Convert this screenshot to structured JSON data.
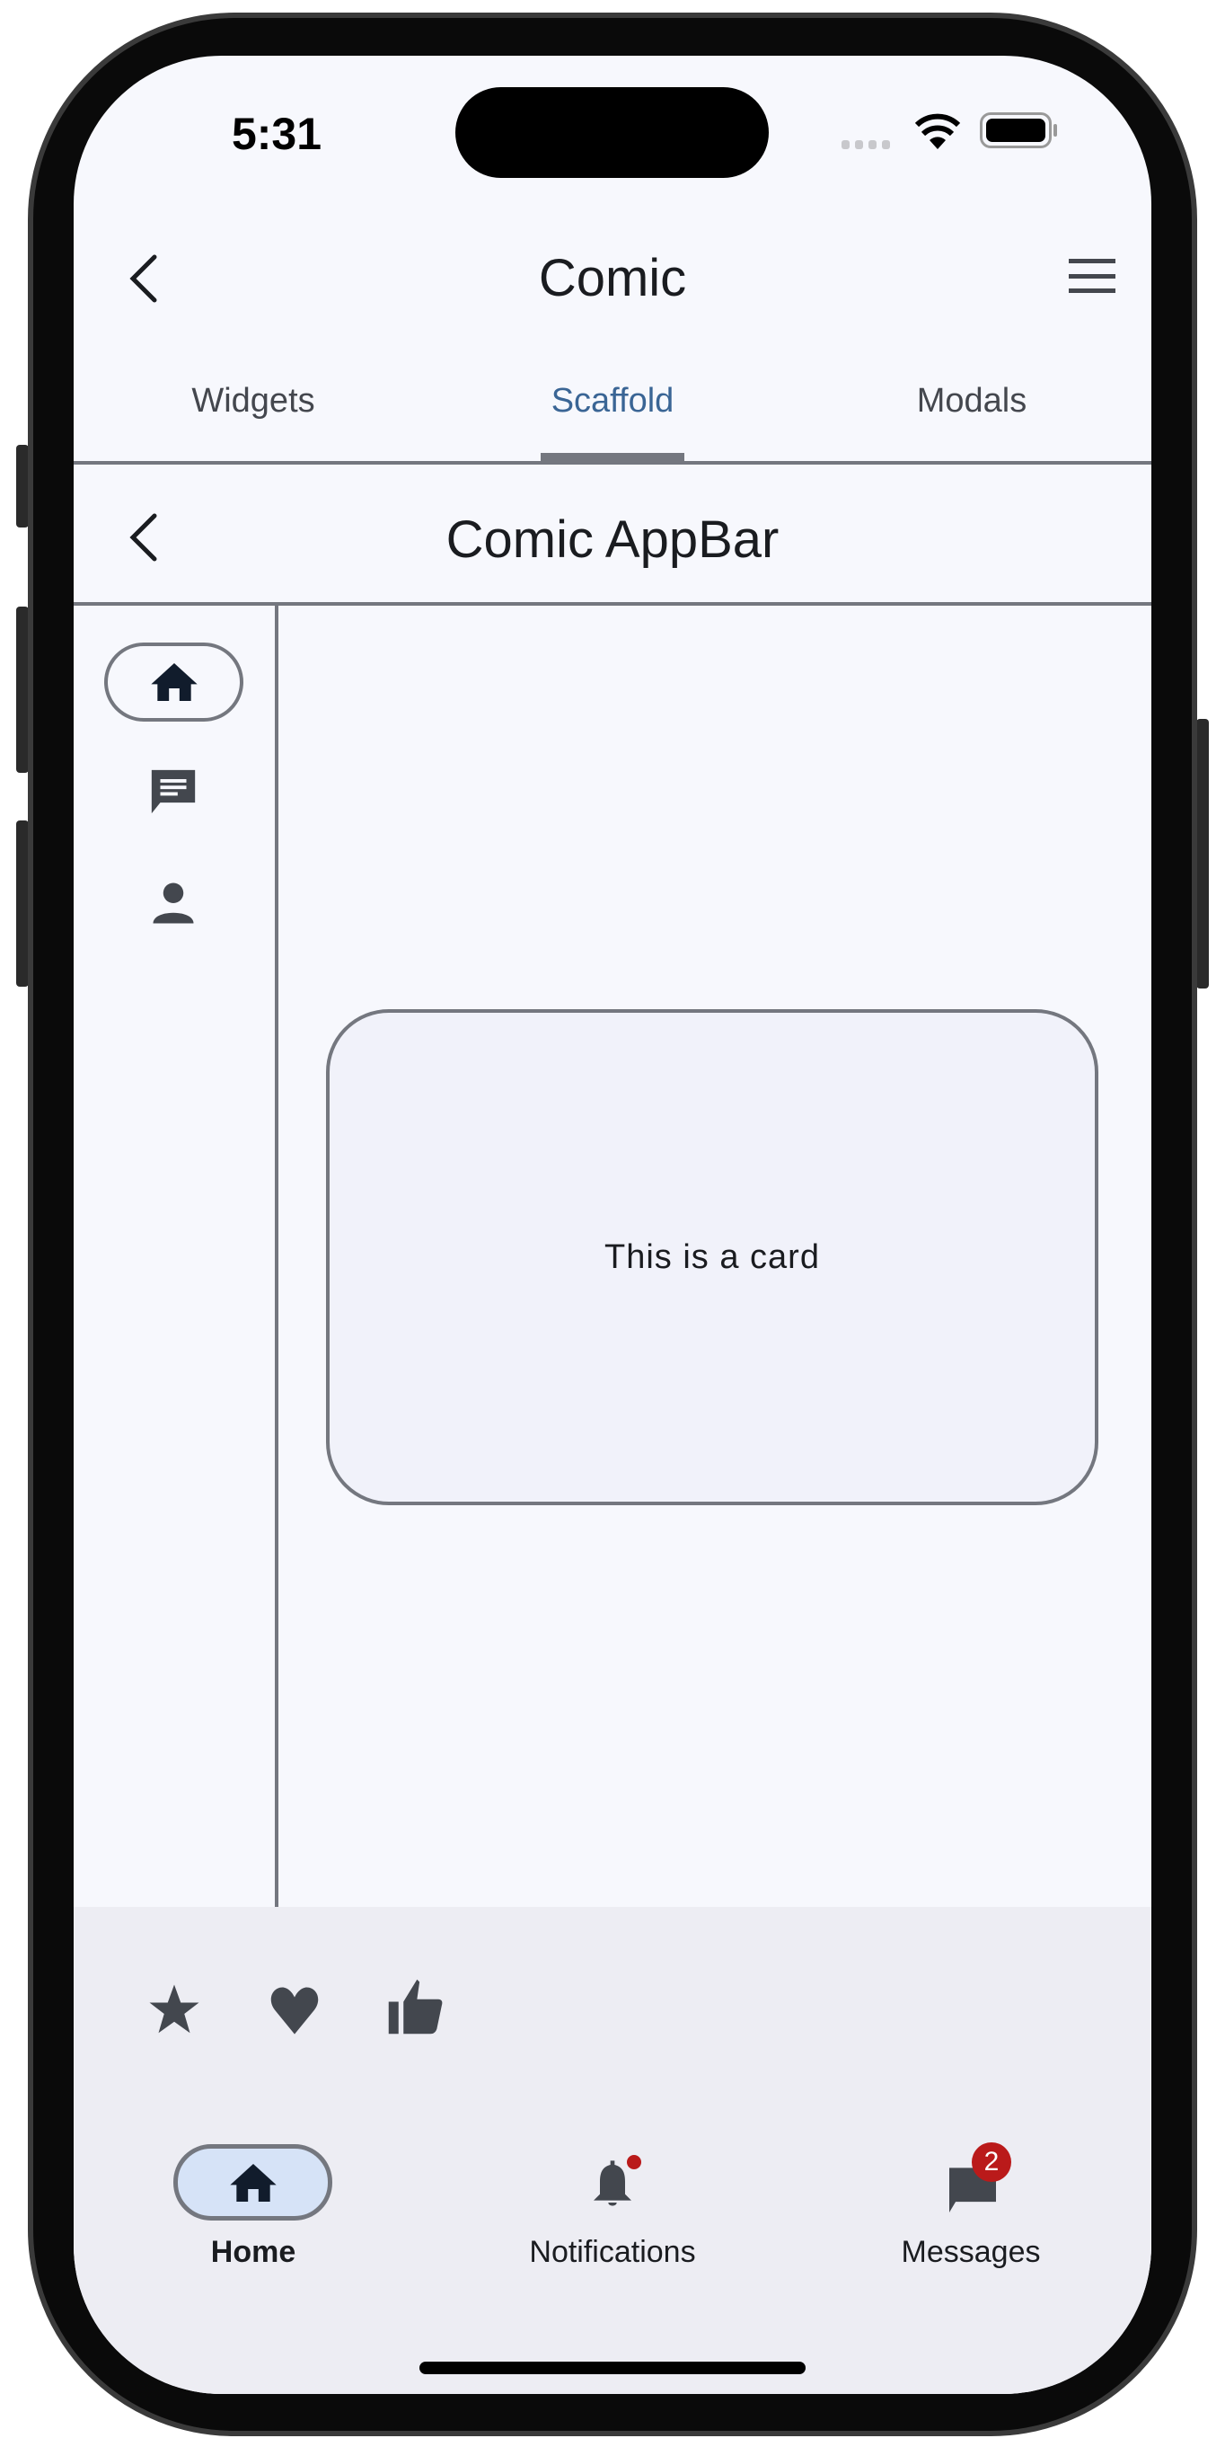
{
  "status_bar": {
    "time": "5:31",
    "wifi_icon": "wifi-icon",
    "battery_icon": "battery-icon"
  },
  "app_bar": {
    "title": "Comic",
    "back_icon": "chevron-left-icon",
    "menu_icon": "hamburger-menu-icon"
  },
  "tabs": [
    {
      "label": "Widgets",
      "active": false
    },
    {
      "label": "Scaffold",
      "active": true
    },
    {
      "label": "Modals",
      "active": false
    }
  ],
  "inner_app_bar": {
    "title": "Comic AppBar",
    "back_icon": "chevron-left-icon"
  },
  "navigation_rail": {
    "items": [
      {
        "icon": "home-icon",
        "selected": true
      },
      {
        "icon": "chat-icon",
        "selected": false
      },
      {
        "icon": "person-icon",
        "selected": false
      }
    ]
  },
  "card": {
    "text": "This is a card"
  },
  "bottom_app_bar": {
    "icons": [
      "star-icon",
      "heart-icon",
      "thumb-up-icon"
    ]
  },
  "bottom_nav": {
    "items": [
      {
        "label": "Home",
        "icon": "home-icon",
        "selected": true
      },
      {
        "label": "Notifications",
        "icon": "bell-icon",
        "dot": true
      },
      {
        "label": "Messages",
        "icon": "message-icon",
        "badge": "2"
      }
    ]
  },
  "colors": {
    "background": "#f7f8fd",
    "surface": "#ededf3",
    "outline": "#74777f",
    "primary": "#3a6595",
    "selected_container": "#d6e3f7",
    "error": "#ba1a1a"
  }
}
